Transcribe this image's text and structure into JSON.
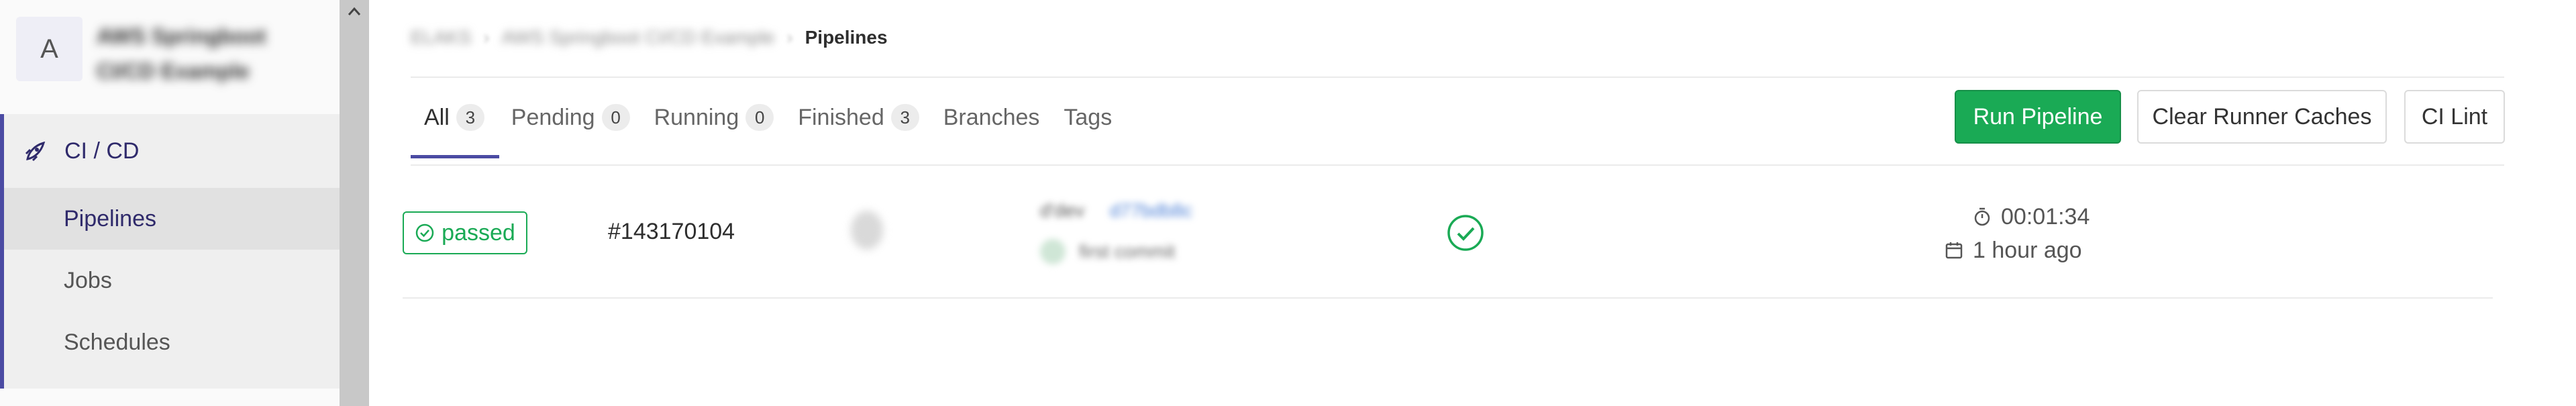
{
  "sidebar": {
    "project_avatar_letter": "A",
    "project_name": "AWS Springboot\nCI/CD Example",
    "nav": {
      "section_label": "CI / CD",
      "items": [
        {
          "label": "Pipelines",
          "active": true
        },
        {
          "label": "Jobs",
          "active": false
        },
        {
          "label": "Schedules",
          "active": false
        }
      ]
    }
  },
  "breadcrumb": {
    "group": "ELAKS",
    "project": "AWS Springboot CI/CD Example",
    "current": "Pipelines"
  },
  "tabs": [
    {
      "label": "All",
      "count": "3"
    },
    {
      "label": "Pending",
      "count": "0"
    },
    {
      "label": "Running",
      "count": "0"
    },
    {
      "label": "Finished",
      "count": "3"
    },
    {
      "label": "Branches",
      "count": null
    },
    {
      "label": "Tags",
      "count": null
    }
  ],
  "actions": {
    "run_pipeline": "Run Pipeline",
    "clear_caches": "Clear Runner Caches",
    "ci_lint": "CI Lint"
  },
  "pipelines": [
    {
      "status": "passed",
      "id": "#143170104",
      "ref": "d'dev",
      "commit_sha": "d77bdb8c",
      "commit_title": "first commit",
      "duration": "00:01:34",
      "finished": "1 hour ago"
    }
  ],
  "colors": {
    "accent": "#4b4ba3",
    "success": "#1aaa55"
  }
}
